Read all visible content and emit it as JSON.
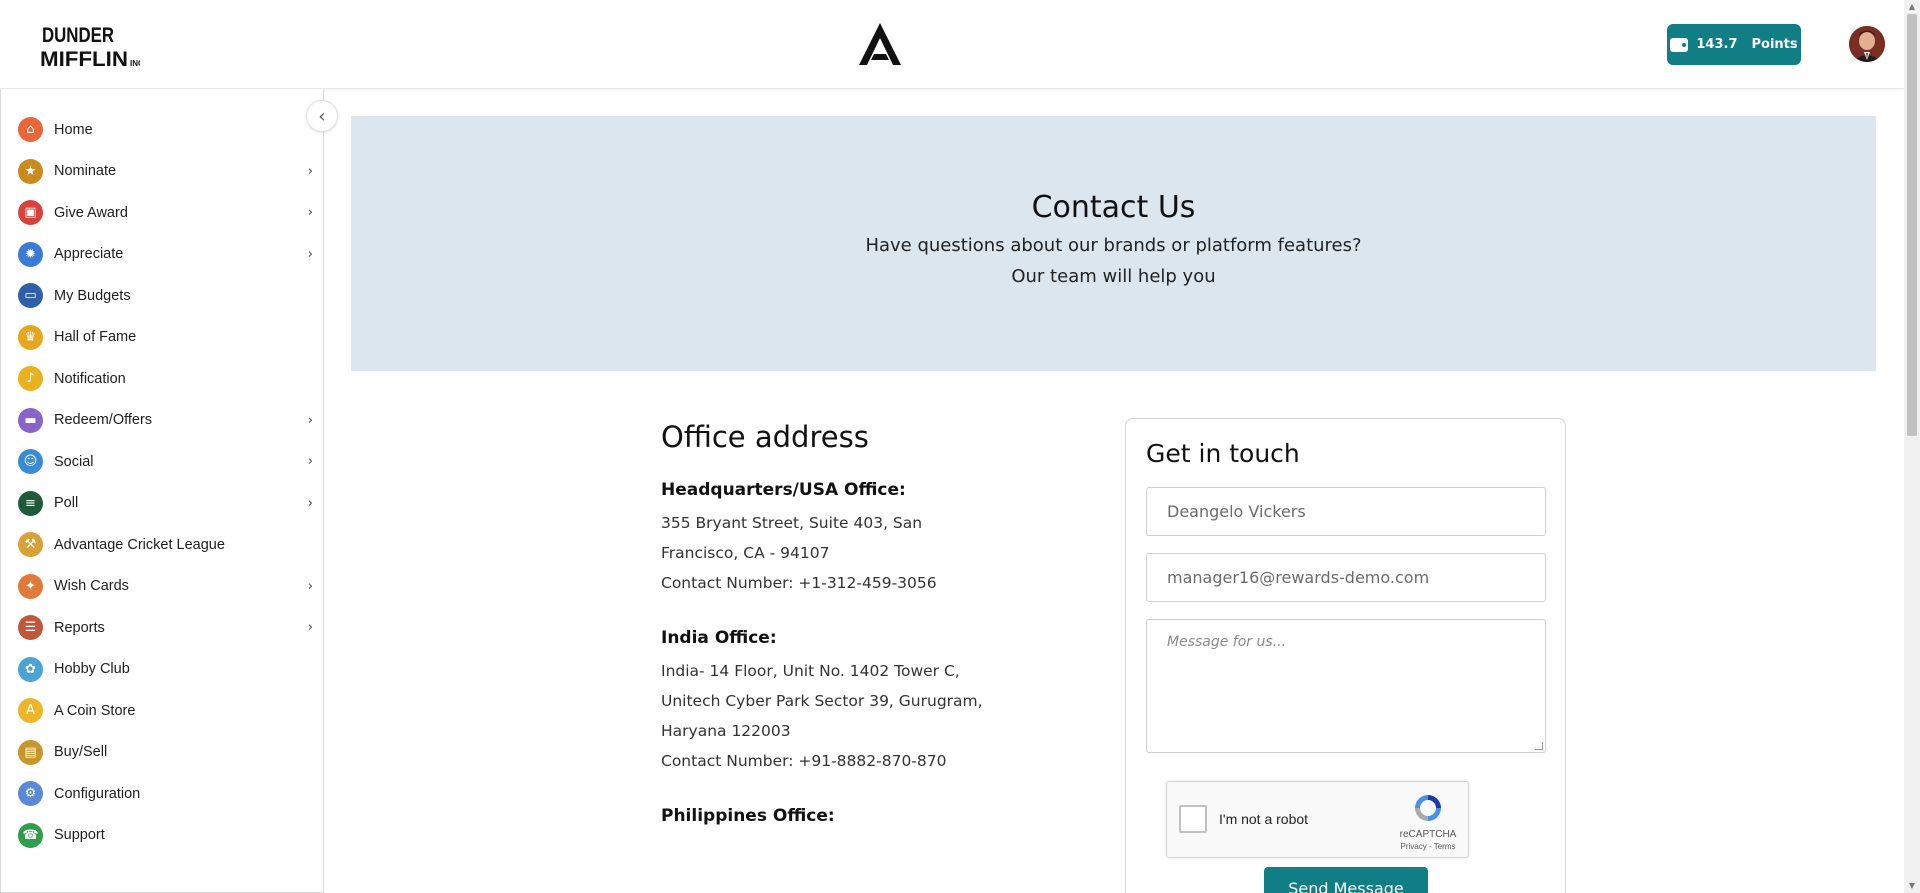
{
  "header": {
    "brand_name": "DUNDER MIFFLIN INC.",
    "points_value": "143.7",
    "points_unit": "Points",
    "icons": [
      "wallet-icon",
      "user-avatar"
    ]
  },
  "sidebar": {
    "items": [
      {
        "label": "Home",
        "icon": "home-icon",
        "color": "#e8663a",
        "chevron": false
      },
      {
        "label": "Nominate",
        "icon": "trophy-icon",
        "color": "#c98a1e",
        "chevron": true
      },
      {
        "label": "Give Award",
        "icon": "gift-icon",
        "color": "#d9423a",
        "chevron": true
      },
      {
        "label": "Appreciate",
        "icon": "medal-icon",
        "color": "#3a7bd5",
        "chevron": true
      },
      {
        "label": "My Budgets",
        "icon": "wallet-icon",
        "color": "#2f5fa8",
        "chevron": false
      },
      {
        "label": "Hall of Fame",
        "icon": "crown-icon",
        "color": "#e6a71e",
        "chevron": false
      },
      {
        "label": "Notification",
        "icon": "bell-icon",
        "color": "#e8b21e",
        "chevron": false
      },
      {
        "label": "Redeem/Offers",
        "icon": "card-icon",
        "color": "#8a63c9",
        "chevron": true
      },
      {
        "label": "Social",
        "icon": "social-icon",
        "color": "#3a8bd5",
        "chevron": true
      },
      {
        "label": "Poll",
        "icon": "poll-icon",
        "color": "#1f5a3a",
        "chevron": true
      },
      {
        "label": "Advantage Cricket League",
        "icon": "cricket-icon",
        "color": "#d8a035",
        "chevron": false
      },
      {
        "label": "Wish Cards",
        "icon": "party-icon",
        "color": "#e07a3a",
        "chevron": true
      },
      {
        "label": "Reports",
        "icon": "clipboard-icon",
        "color": "#c0573a",
        "chevron": true
      },
      {
        "label": "Hobby Club",
        "icon": "palette-icon",
        "color": "#4aa3d5",
        "chevron": false
      },
      {
        "label": "A Coin Store",
        "icon": "coin-icon",
        "color": "#f0b429",
        "chevron": false
      },
      {
        "label": "Buy/Sell",
        "icon": "bag-icon",
        "color": "#c9962a",
        "chevron": false
      },
      {
        "label": "Configuration",
        "icon": "settings-icon",
        "color": "#5a8ad5",
        "chevron": false
      },
      {
        "label": "Support",
        "icon": "phone-icon",
        "color": "#2e9e4a",
        "chevron": false
      }
    ]
  },
  "banner": {
    "title": "Contact Us",
    "line1": "Have questions about our brands or platform features?",
    "line2": "Our team will help you"
  },
  "office": {
    "title": "Office address",
    "hq_title": "Headquarters/USA Office:",
    "hq_line1": "355 Bryant Street, Suite 403, San",
    "hq_line2": "Francisco, CA - 94107",
    "hq_contact": "Contact Number: +1-312-459-3056",
    "india_title": "India Office:",
    "india_line1": "India- 14 Floor, Unit No. 1402 Tower C,",
    "india_line2": "Unitech Cyber Park Sector 39, Gurugram,",
    "india_line3": "Haryana 122003",
    "india_contact": "Contact Number: +91-8882-870-870",
    "ph_title": "Philippines Office:"
  },
  "contact_form": {
    "title": "Get in touch",
    "name_value": "Deangelo Vickers",
    "email_value": "manager16@rewards-demo.com",
    "message_placeholder": "Message for us...",
    "captcha_label": "I'm not a robot",
    "captcha_brand": "reCAPTCHA",
    "captcha_terms": "Privacy - Terms",
    "send_label": "Send Message",
    "accent_color": "#117e86"
  }
}
